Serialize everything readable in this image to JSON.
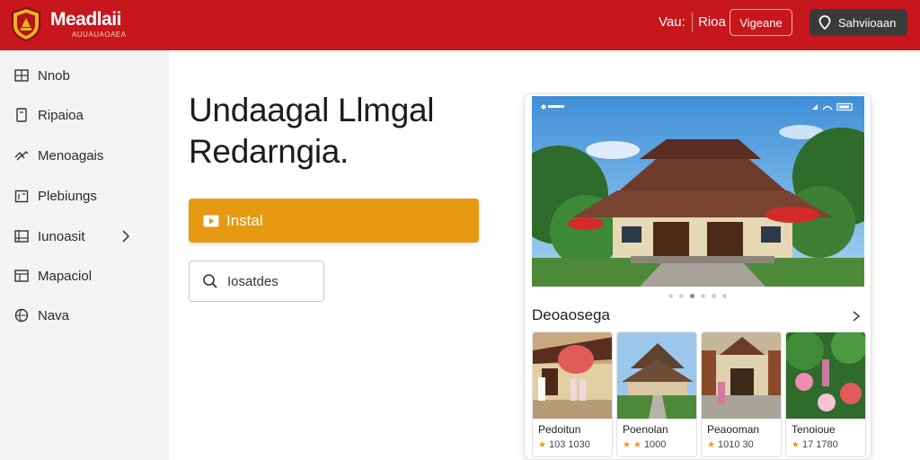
{
  "header": {
    "brand": "Meadlaii",
    "brand_sub": "AUUAUAOAEA",
    "nav": [
      "Vau:",
      "Rioa"
    ],
    "outline_button": "Vigeane",
    "dark_button": "Sahviioaan",
    "colors": {
      "bar": "#c8161d",
      "dark_button": "#3a3a3a"
    },
    "icons": {
      "logo": "shield-crest-icon",
      "dark_button": "location-pin-icon"
    }
  },
  "sidebar": {
    "items": [
      {
        "label": "Nnob",
        "icon": "grid-icon"
      },
      {
        "label": "Ripaioa",
        "icon": "bookmark-icon"
      },
      {
        "label": "Menoagais",
        "icon": "hands-icon"
      },
      {
        "label": "Plebiungs",
        "icon": "calendar-icon"
      },
      {
        "label": "Iunoasit",
        "icon": "grid-icon",
        "has_chevron": true
      },
      {
        "label": "Mapaciol",
        "icon": "map-icon"
      },
      {
        "label": "Nava",
        "icon": "globe-icon"
      }
    ]
  },
  "hero": {
    "title_line1": "Undaagal Llmgal",
    "title_line2": "Redarngia."
  },
  "install": {
    "label": "Instal",
    "icon": "play-icon",
    "color": "#e59a12"
  },
  "search": {
    "placeholder": "Iosatdes",
    "icon": "search-icon"
  },
  "card": {
    "carousel": {
      "count": 6,
      "active_index": 2
    },
    "section_title": "Deoaosega",
    "tiles": [
      {
        "name": "Pedoitun",
        "meta": "103 1030"
      },
      {
        "name": "Poenolan",
        "meta": "1000"
      },
      {
        "name": "Peaooman",
        "meta": "1010 30"
      },
      {
        "name": "Tenoioue",
        "meta": "17 1780"
      }
    ]
  }
}
